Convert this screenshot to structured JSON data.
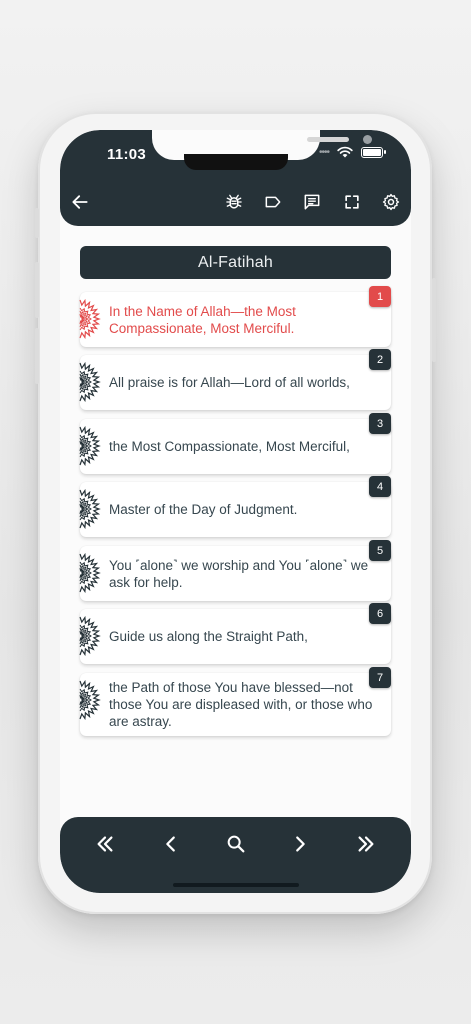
{
  "status_bar": {
    "time": "11:03",
    "icons": [
      "cellular-dots-icon",
      "wifi-icon",
      "battery-icon"
    ]
  },
  "toolbar": {
    "icons": [
      "back-arrow-icon",
      "bug-icon",
      "label-tag-icon",
      "notes-icon",
      "fullscreen-icon",
      "settings-gear-icon"
    ]
  },
  "surah": {
    "title": "Al-Fatihah"
  },
  "ayahs": [
    {
      "number": "1",
      "text": "In the Name of Allah—the Most Compassionate, Most Merciful."
    },
    {
      "number": "2",
      "text": "All praise is for Allah—Lord of all worlds,"
    },
    {
      "number": "3",
      "text": "the Most Compassionate, Most Merciful,"
    },
    {
      "number": "4",
      "text": "Master of the Day of Judgment."
    },
    {
      "number": "5",
      "text": "You ˹alone˺ we worship and You ˹alone˺ we ask for help."
    },
    {
      "number": "6",
      "text": "Guide us along the Straight Path,"
    },
    {
      "number": "7",
      "text": "the Path of those You have blessed—not those You are displeased with, or those who are astray."
    }
  ],
  "bottom_nav": {
    "icons": [
      "first-double-chevron-icon",
      "previous-chevron-icon",
      "search-icon",
      "next-chevron-icon",
      "last-double-chevron-icon"
    ]
  },
  "colors": {
    "bar_dark": "#263238",
    "active_red": "#e24b4b",
    "text": "#37474f"
  }
}
